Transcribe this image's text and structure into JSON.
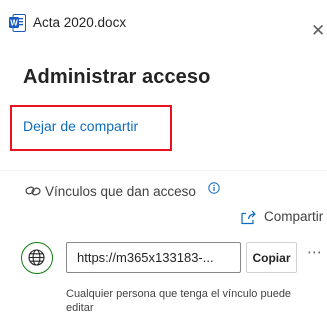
{
  "header": {
    "file_name": "Acta 2020.docx",
    "file_icon": "word-document-icon",
    "close_icon": "close-icon",
    "close_glyph": "✕"
  },
  "title": "Administrar acceso",
  "stop_sharing_label": "Dejar de compartir",
  "links_section": {
    "label": "Vínculos que dan acceso",
    "link_icon": "link-icon",
    "info_icon": "info-icon",
    "share_label": "Compartir",
    "share_icon": "share-icon"
  },
  "link_item": {
    "type_icon": "globe-icon",
    "url": "https://m365x133183-...",
    "copy_label": "Copiar",
    "more_glyph": "⋯",
    "permission_text": "Cualquier persona que tenga el vínculo puede editar"
  },
  "colors": {
    "accent": "#0f6cbd",
    "globe": "#107c10",
    "highlight_border": "#e81123",
    "word_blue": "#185abd"
  }
}
